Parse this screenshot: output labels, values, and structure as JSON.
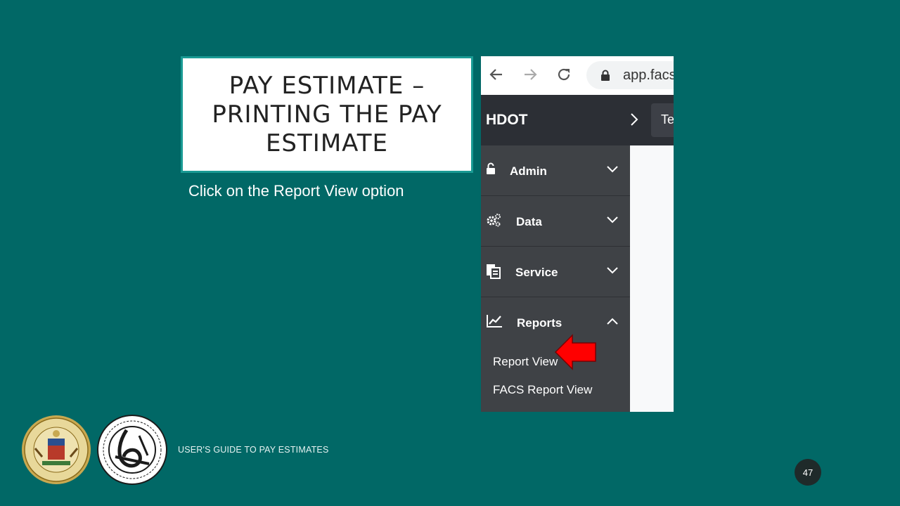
{
  "slide": {
    "title_lines": [
      "PAY ESTIMATE –",
      "PRINTING THE PAY",
      "ESTIMATE"
    ],
    "subtitle": "Click on the Report View option",
    "footer": "USER'S GUIDE TO PAY ESTIMATES",
    "page_number": "47"
  },
  "browser": {
    "url": "app.facs"
  },
  "app": {
    "brand": "HDOT",
    "header_tab": "Te",
    "sidebar": {
      "items": [
        {
          "label": "Admin",
          "icon": "lock-open-icon",
          "expanded": false
        },
        {
          "label": "Data",
          "icon": "gears-icon",
          "expanded": false
        },
        {
          "label": "Service",
          "icon": "documents-icon",
          "expanded": false
        },
        {
          "label": "Reports",
          "icon": "chart-line-icon",
          "expanded": true
        }
      ],
      "report_subitems": [
        "Report View",
        "FACS Report View"
      ]
    }
  },
  "colors": {
    "slide_bg": "#016866",
    "sidebar_bg": "#3f4246",
    "header_bg": "#2c2f35",
    "arrow": "#ff0000"
  }
}
